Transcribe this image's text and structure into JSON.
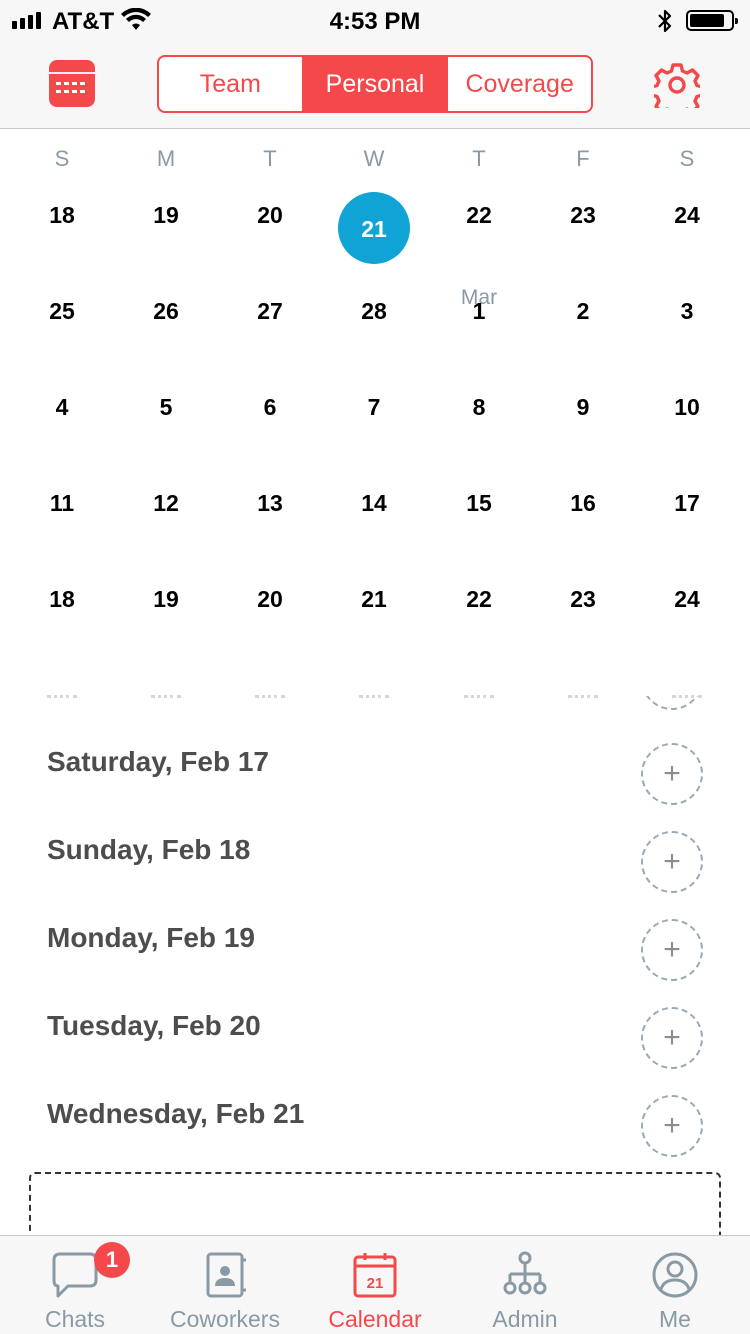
{
  "status_bar": {
    "carrier": "AT&T",
    "time": "4:53 PM",
    "battery_level": 0.85
  },
  "header": {
    "calendar_icon": "calendar-grid-icon",
    "settings_icon": "gear-icon",
    "segments": [
      {
        "label": "Team",
        "active": false
      },
      {
        "label": "Personal",
        "active": true
      },
      {
        "label": "Coverage",
        "active": false
      }
    ]
  },
  "calendar": {
    "weekdays": [
      "S",
      "M",
      "T",
      "W",
      "T",
      "F",
      "S"
    ],
    "today_color": "#0fa3d6",
    "weeks": [
      {
        "days": [
          "18",
          "19",
          "20",
          "21",
          "22",
          "23",
          "24"
        ]
      },
      {
        "days": [
          "25",
          "26",
          "27",
          "28",
          "1",
          "2",
          "3"
        ],
        "month_label": "Mar",
        "month_label_day_index": 4
      },
      {
        "days": [
          "4",
          "5",
          "6",
          "7",
          "8",
          "9",
          "10"
        ]
      },
      {
        "days": [
          "11",
          "12",
          "13",
          "14",
          "15",
          "16",
          "17"
        ]
      },
      {
        "days": [
          "18",
          "19",
          "20",
          "21",
          "22",
          "23",
          "24"
        ]
      }
    ],
    "today": "21"
  },
  "agenda": {
    "add_icon": "plus-icon",
    "add_symbol": "+",
    "items": [
      {
        "date": "Saturday, Feb 17"
      },
      {
        "date": "Sunday, Feb 18"
      },
      {
        "date": "Monday, Feb 19"
      },
      {
        "date": "Tuesday, Feb 20"
      },
      {
        "date": "Wednesday, Feb 21"
      }
    ]
  },
  "tab_bar": {
    "accent": "#f5484a",
    "inactive_color": "#8a9aa5",
    "tabs": [
      {
        "label": "Chats",
        "icon": "chat-bubble-icon",
        "badge": "1",
        "active": false
      },
      {
        "label": "Coworkers",
        "icon": "contact-book-icon",
        "active": false
      },
      {
        "label": "Calendar",
        "icon": "calendar-icon",
        "icon_text": "21",
        "active": true
      },
      {
        "label": "Admin",
        "icon": "org-chart-icon",
        "active": false
      },
      {
        "label": "Me",
        "icon": "user-profile-icon",
        "active": false
      }
    ]
  }
}
